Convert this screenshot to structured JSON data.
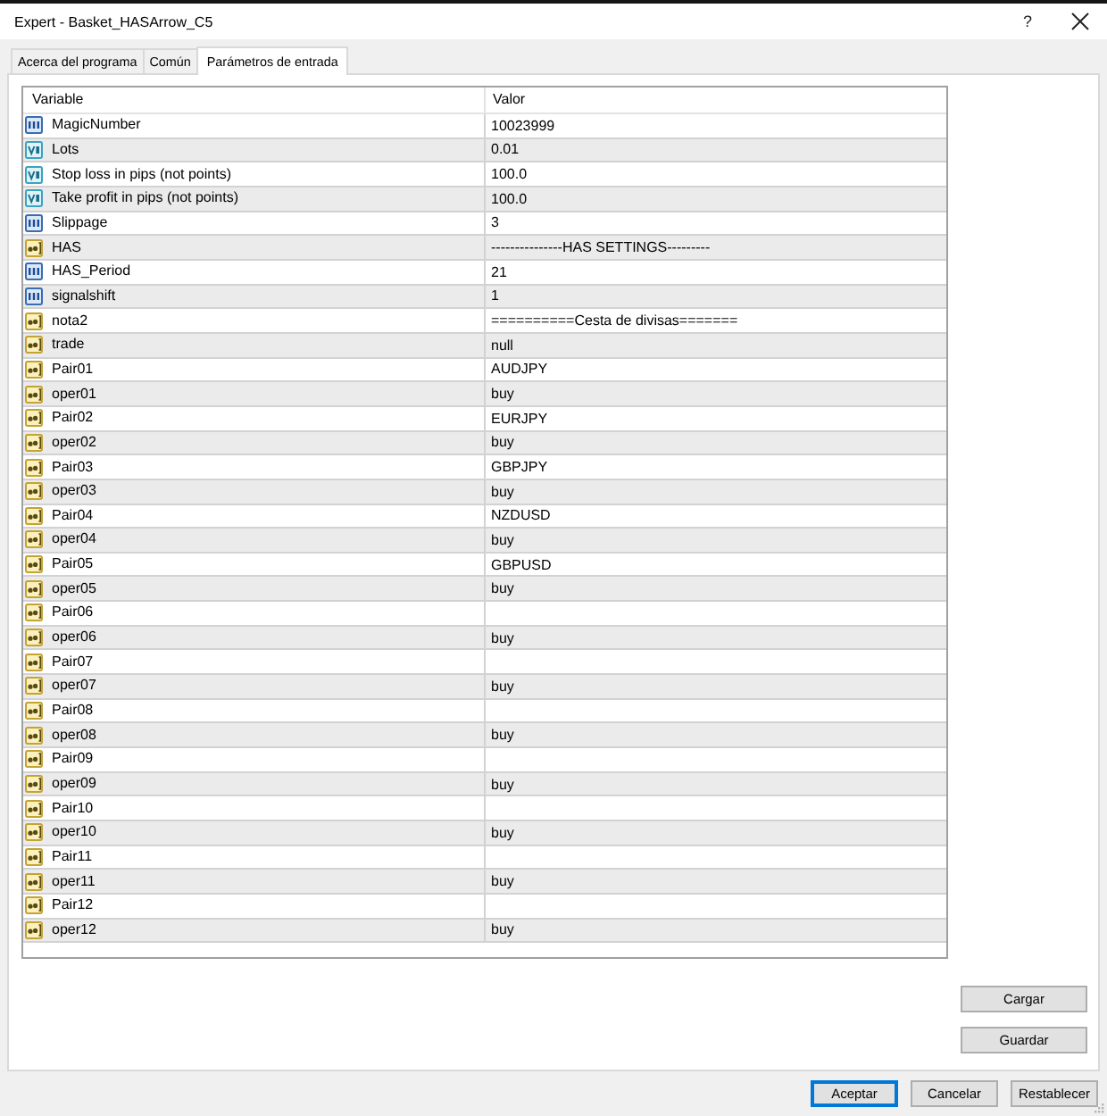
{
  "window": {
    "title": "Expert - Basket_HASArrow_C5",
    "help_button": "?"
  },
  "tabs": [
    {
      "label": "Acerca del programa",
      "selected": false
    },
    {
      "label": "Común",
      "selected": false
    },
    {
      "label": "Parámetros de entrada",
      "selected": true
    }
  ],
  "parameters": {
    "columns": [
      "Variable",
      "Valor"
    ],
    "rows": [
      {
        "kind": "int",
        "name": "MagicNumber",
        "value": "10023999"
      },
      {
        "kind": "double",
        "name": "Lots",
        "value": "0.01"
      },
      {
        "kind": "double",
        "name": "Stop loss in pips (not points)",
        "value": "100.0"
      },
      {
        "kind": "double",
        "name": "Take profit in pips (not points)",
        "value": "100.0"
      },
      {
        "kind": "int",
        "name": "Slippage",
        "value": "3"
      },
      {
        "kind": "string",
        "name": "HAS",
        "value": "---------------HAS SETTINGS---------"
      },
      {
        "kind": "int",
        "name": "HAS_Period",
        "value": "21"
      },
      {
        "kind": "int",
        "name": "signalshift",
        "value": "1"
      },
      {
        "kind": "string",
        "name": "nota2",
        "value": "==========Cesta de divisas======="
      },
      {
        "kind": "string",
        "name": "trade",
        "value": "null"
      },
      {
        "kind": "string",
        "name": "Pair01",
        "value": "AUDJPY"
      },
      {
        "kind": "string",
        "name": "oper01",
        "value": "buy"
      },
      {
        "kind": "string",
        "name": "Pair02",
        "value": "EURJPY"
      },
      {
        "kind": "string",
        "name": "oper02",
        "value": "buy"
      },
      {
        "kind": "string",
        "name": "Pair03",
        "value": "GBPJPY"
      },
      {
        "kind": "string",
        "name": "oper03",
        "value": "buy"
      },
      {
        "kind": "string",
        "name": "Pair04",
        "value": "NZDUSD"
      },
      {
        "kind": "string",
        "name": "oper04",
        "value": "buy"
      },
      {
        "kind": "string",
        "name": "Pair05",
        "value": "GBPUSD"
      },
      {
        "kind": "string",
        "name": "oper05",
        "value": "buy"
      },
      {
        "kind": "string",
        "name": "Pair06"
      },
      {
        "kind": "string",
        "name": "oper06",
        "value": "buy"
      },
      {
        "kind": "string",
        "name": "Pair07"
      },
      {
        "kind": "string",
        "name": "oper07",
        "value": "buy"
      },
      {
        "kind": "string",
        "name": "Pair08"
      },
      {
        "kind": "string",
        "name": "oper08",
        "value": "buy"
      },
      {
        "kind": "string",
        "name": "Pair09"
      },
      {
        "kind": "string",
        "name": "oper09",
        "value": "buy"
      },
      {
        "kind": "string",
        "name": "Pair10"
      },
      {
        "kind": "string",
        "name": "oper10",
        "value": "buy"
      },
      {
        "kind": "string",
        "name": "Pair11"
      },
      {
        "kind": "string",
        "name": "oper11",
        "value": "buy"
      },
      {
        "kind": "string",
        "name": "Pair12"
      },
      {
        "kind": "string",
        "name": "oper12",
        "value": "buy"
      }
    ]
  },
  "side_buttons": [
    "Cargar",
    "Guardar"
  ],
  "buttons": [
    {
      "label": "Aceptar",
      "default": true
    },
    {
      "label": "Cancelar",
      "default": false
    },
    {
      "label": "Restablecer",
      "default": false
    }
  ]
}
